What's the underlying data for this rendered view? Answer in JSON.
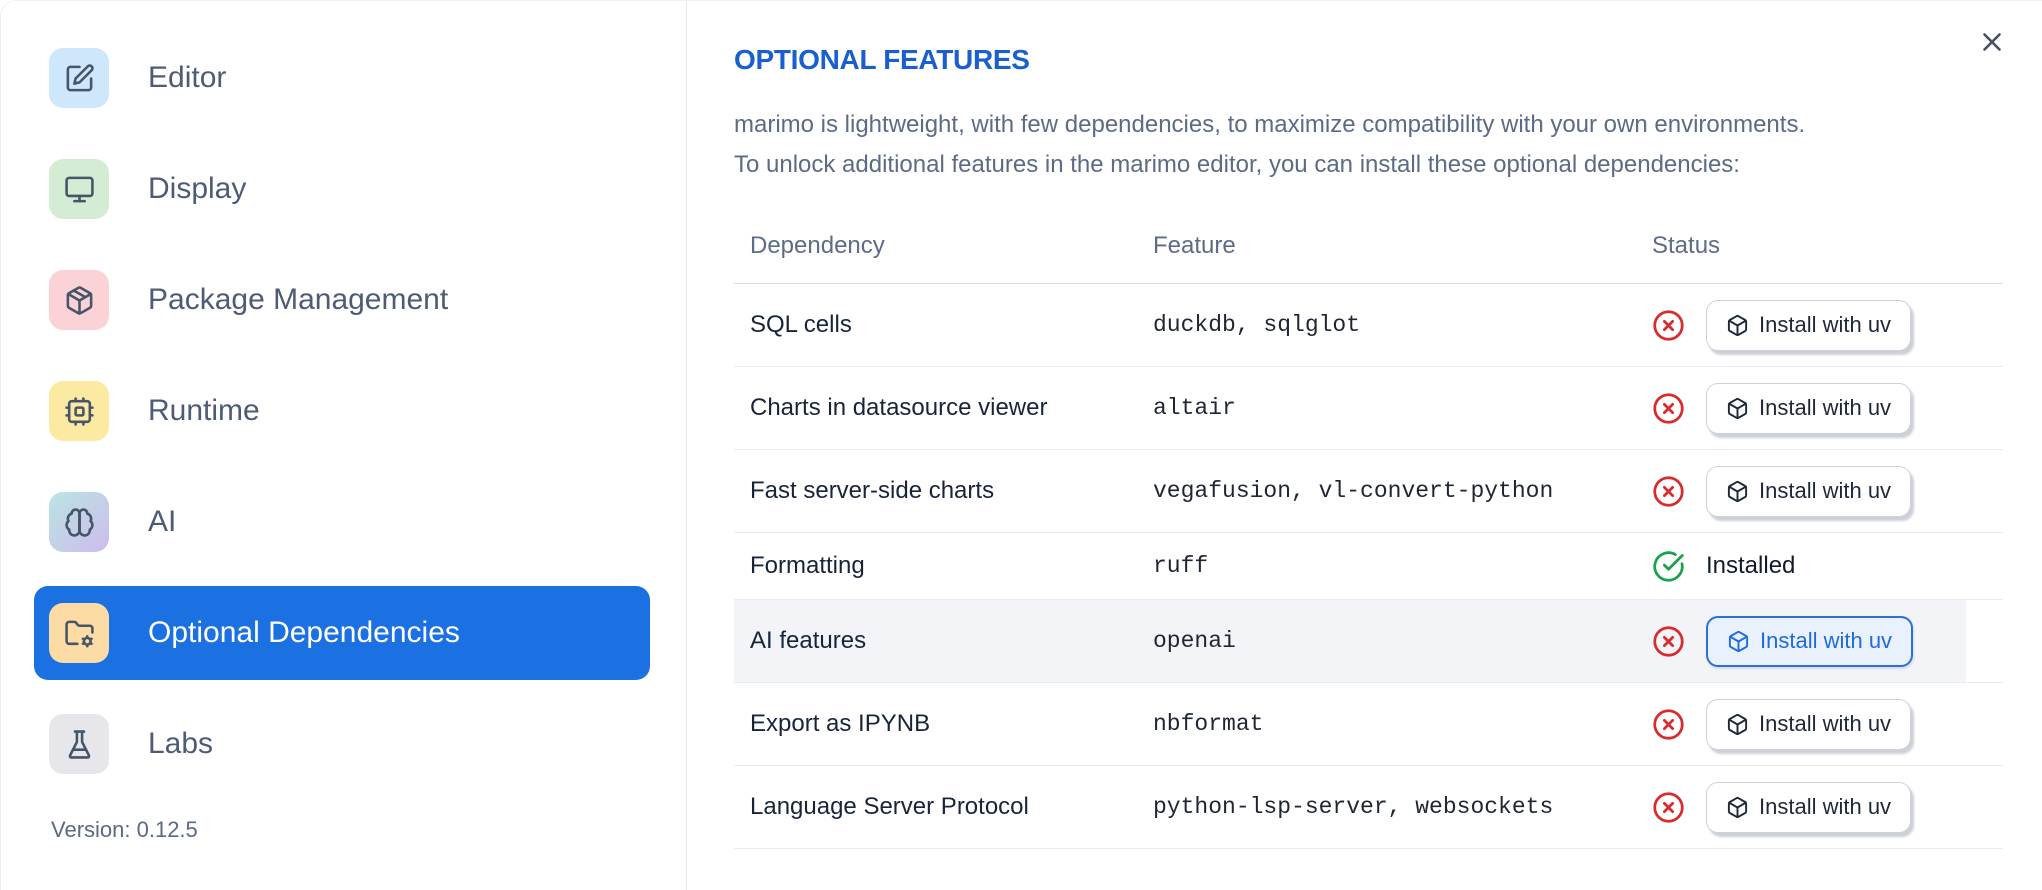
{
  "sidebar": {
    "items": [
      {
        "label": "Editor",
        "icon": "square-pen",
        "icon_bg": "#cfe7fb",
        "selected": false
      },
      {
        "label": "Display",
        "icon": "monitor",
        "icon_bg": "#d4ecd4",
        "selected": false
      },
      {
        "label": "Package Management",
        "icon": "package",
        "icon_bg": "#fbd3d6",
        "selected": false
      },
      {
        "label": "Runtime",
        "icon": "cpu",
        "icon_bg": "#fdeaa2",
        "selected": false
      },
      {
        "label": "AI",
        "icon": "brain",
        "icon_bg": "#b9e5e2",
        "icon_bg_to": "#cfbbee",
        "selected": false
      },
      {
        "label": "Optional Dependencies",
        "icon": "folder-cog",
        "icon_bg": "#fcdca4",
        "selected": true
      },
      {
        "label": "Labs",
        "icon": "flask",
        "icon_bg": "#e7e7eb",
        "selected": false
      }
    ],
    "version_label": "Version: 0.12.5"
  },
  "panel": {
    "title": "OPTIONAL FEATURES",
    "description_lines": [
      "marimo is lightweight, with few dependencies, to maximize compatibility with your own environments.",
      "To unlock additional features in the marimo editor, you can install these optional dependencies:"
    ]
  },
  "table": {
    "columns": [
      "Dependency",
      "Feature",
      "Status"
    ],
    "install_button_label": "Install with uv",
    "installed_label": "Installed",
    "rows": [
      {
        "dependency": "SQL cells",
        "feature": "duckdb, sqlglot",
        "installed": false,
        "highlighted": false
      },
      {
        "dependency": "Charts in datasource viewer",
        "feature": "altair",
        "installed": false,
        "highlighted": false
      },
      {
        "dependency": "Fast server-side charts",
        "feature": "vegafusion, vl-convert-python",
        "installed": false,
        "highlighted": false
      },
      {
        "dependency": "Formatting",
        "feature": "ruff",
        "installed": true,
        "highlighted": false
      },
      {
        "dependency": "AI features",
        "feature": "openai",
        "installed": false,
        "highlighted": true
      },
      {
        "dependency": "Export as IPYNB",
        "feature": "nbformat",
        "installed": false,
        "highlighted": false
      },
      {
        "dependency": "Language Server Protocol",
        "feature": "python-lsp-server, websockets",
        "installed": false,
        "highlighted": false
      }
    ]
  },
  "colors": {
    "accent_blue": "#1b70e2",
    "title_blue": "#1a5fd0",
    "status_error_red": "#d92b2b",
    "status_success_green": "#16a34a",
    "focused_button_blue": "#1e6be0"
  }
}
